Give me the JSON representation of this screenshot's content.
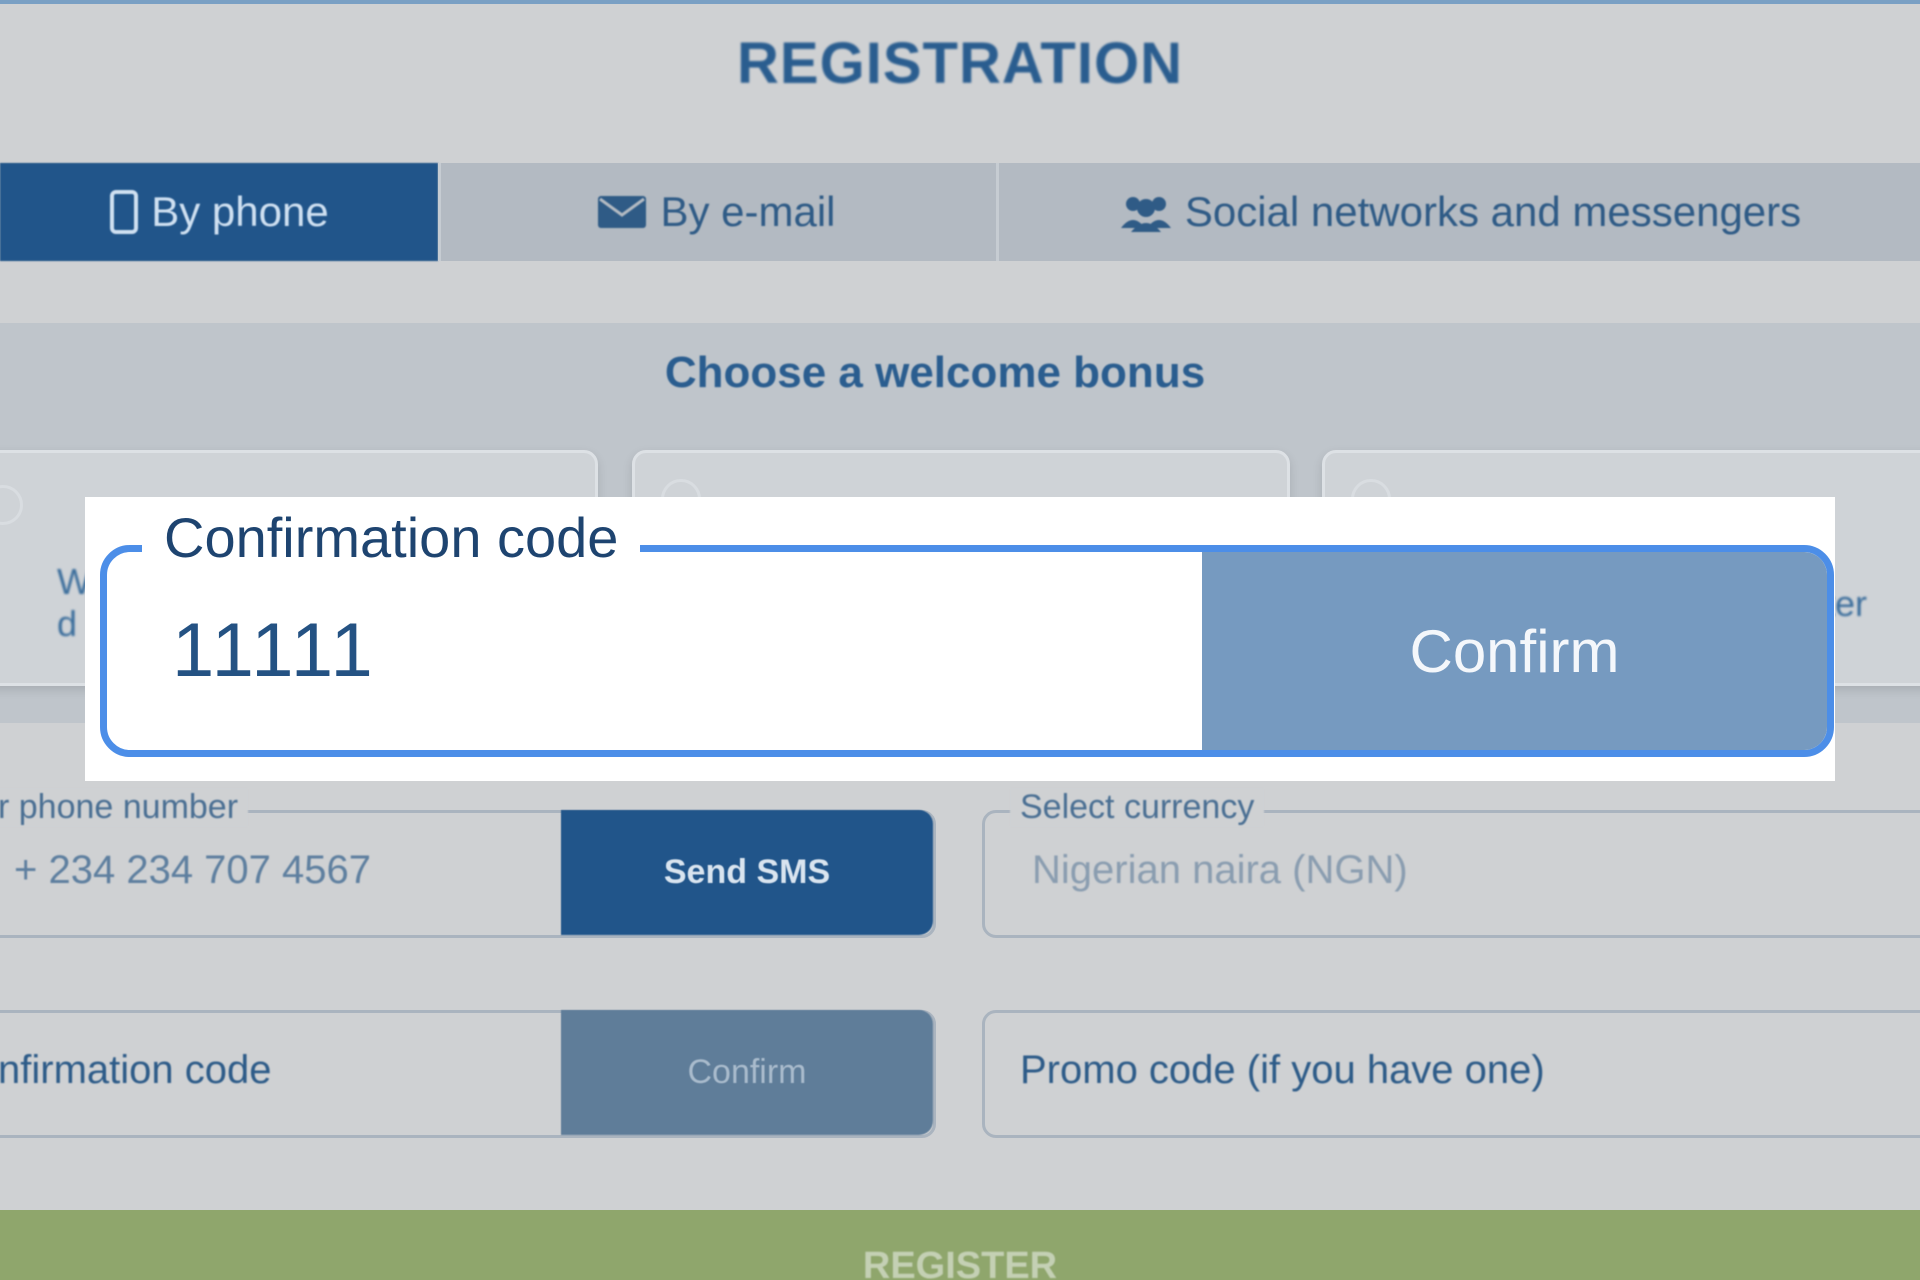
{
  "page": {
    "title": "REGISTRATION"
  },
  "tabs": [
    {
      "label": "By phone",
      "icon": "phone-icon",
      "active": true
    },
    {
      "label": "By e-mail",
      "icon": "envelope-icon",
      "active": false
    },
    {
      "label": "Social networks and messengers",
      "icon": "users-icon",
      "active": false
    }
  ],
  "bonus": {
    "title": "Choose a welcome bonus",
    "cards": [
      {
        "text_lines": [
          "W",
          "d"
        ]
      },
      {
        "text_lines": []
      },
      {
        "text_lines": [
          "ter"
        ]
      }
    ]
  },
  "phone_field": {
    "label": "r phone number",
    "value": "+ 234  234 707 4567",
    "button_label": "Send SMS"
  },
  "currency_field": {
    "label": "Select currency",
    "value": "Nigerian naira (NGN)"
  },
  "code_field": {
    "placeholder": "nfirmation code",
    "button_label": "Confirm"
  },
  "promo_field": {
    "placeholder": "Promo code (if you have one)"
  },
  "register": {
    "label": "REGISTER"
  },
  "highlight": {
    "label": "Confirmation code",
    "value": "11111",
    "button_label": "Confirm"
  },
  "colors": {
    "brand_blue": "#21558a",
    "highlight_border": "#4c8ee8",
    "confirm_button": "#769ac0",
    "register_green": "#8fa66c"
  }
}
